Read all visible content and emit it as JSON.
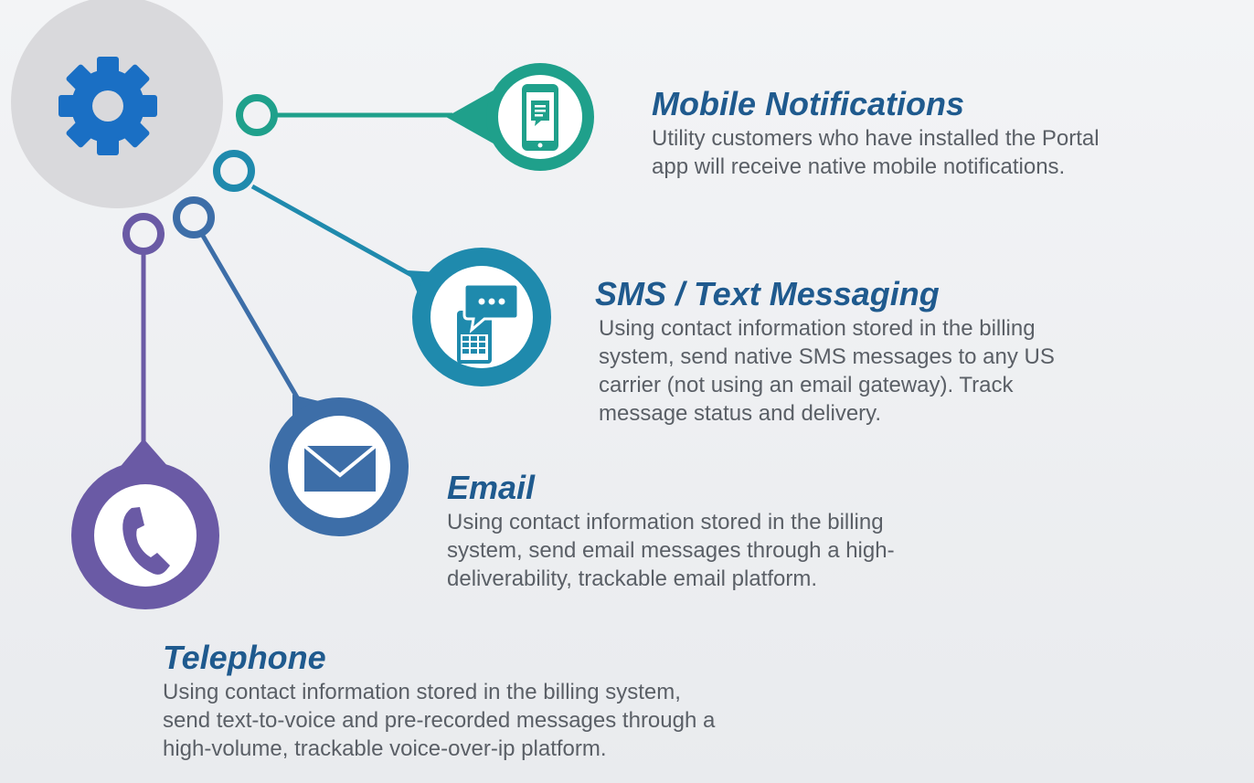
{
  "channels": {
    "mobile": {
      "title": "Mobile Notifications",
      "lines": [
        "Utility customers who have installed the Portal",
        "app will receive native mobile notifications."
      ],
      "color": "#1fa08b",
      "icon": "mobile-phone-message-icon"
    },
    "sms": {
      "title": "SMS / Text Messaging",
      "lines": [
        "Using contact information stored in the billing",
        "system, send native SMS messages to any US",
        "carrier (not using an email gateway).  Track",
        "message status and delivery."
      ],
      "color": "#1f8aad",
      "icon": "speech-bubble-phone-icon"
    },
    "email": {
      "title": "Email",
      "lines": [
        "Using contact information stored in the billing",
        "system, send email messages through a high-",
        "deliverability, trackable email platform."
      ],
      "color": "#3d6ea8",
      "icon": "envelope-icon"
    },
    "telephone": {
      "title": "Telephone",
      "lines": [
        "Using contact information stored in the billing system,",
        "send text-to-voice and pre-recorded messages through a",
        "high-volume, trackable voice-over-ip platform."
      ],
      "color": "#6a5aa5",
      "icon": "telephone-handset-icon"
    }
  },
  "hub": {
    "icon": "gear-icon",
    "color": "#1a6fc4",
    "background": "#d9d9dc"
  },
  "text_color": "#5a5f66",
  "title_color": "#1f5a8e"
}
